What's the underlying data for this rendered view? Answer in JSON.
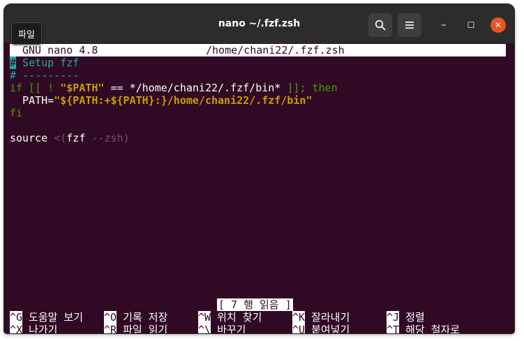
{
  "window": {
    "title": "nano ~/.fzf.zsh",
    "tooltip": "파일"
  },
  "titlebar": {
    "search_icon": "search-icon",
    "menu_icon": "hamburger-menu-icon",
    "minimize_glyph": "–",
    "maximize_glyph": "☐",
    "close_glyph": "✕"
  },
  "colors": {
    "terminal_bg": "#300a24",
    "titlebar_bg": "#2c2c2c",
    "close_accent": "#e95420",
    "comment": "#2aa7a0",
    "keyword": "#4e9a06",
    "string": "#c4a000"
  },
  "nano": {
    "version": "GNU nano 4.8",
    "file_path": "/home/chani22/.fzf.zsh",
    "status_message": "[ 7 행 읽음 ]"
  },
  "editor": {
    "line1_hash": "#",
    "line1_rest": " Setup fzf",
    "line2": "# ---------",
    "line3_if": "if [[ ! ",
    "line3_var": "\"$PATH\"",
    "line3_mid": " == */home/chani22/.fzf/bin* ",
    "line3_end": "]]; then",
    "line4_pre": "  PATH=",
    "line4_str": "\"${PATH:+${PATH}:}/home/chani22/.fzf/bin\"",
    "line5": "fi",
    "line7_source": "source ",
    "line7_lt": "<(",
    "line7_fzf": "fzf ",
    "line7_flag": "--zsh",
    "line7_close": ")"
  },
  "shortcuts": [
    {
      "key": "^G",
      "label": "도움말 보기"
    },
    {
      "key": "^O",
      "label": "기록 저장"
    },
    {
      "key": "^W",
      "label": "위치 찾기"
    },
    {
      "key": "^K",
      "label": "잘라내기"
    },
    {
      "key": "^J",
      "label": "정렬"
    },
    {
      "key": "^X",
      "label": "나가기"
    },
    {
      "key": "^R",
      "label": "파일 읽기"
    },
    {
      "key": "^\\",
      "label": "바꾸기"
    },
    {
      "key": "^U",
      "label": "붙여넣기"
    },
    {
      "key": "^T",
      "label": "해당 철자로"
    }
  ]
}
